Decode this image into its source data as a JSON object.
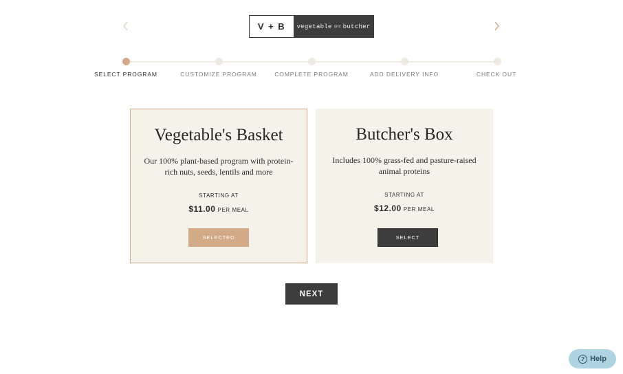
{
  "header": {
    "logo_mark": "V + B",
    "logo_word_left": "vegetable",
    "logo_word_and": "and",
    "logo_word_right": "butcher",
    "prev_icon": "chevron-left-icon",
    "next_icon": "chevron-right-icon",
    "prev_color": "#e0d3c4",
    "next_color": "#d2aa87"
  },
  "stepper": {
    "current_step": 1,
    "steps": [
      {
        "label": "SELECT PROGRAM"
      },
      {
        "label": "CUSTOMIZE PROGRAM"
      },
      {
        "label": "COMPLETE PROGRAM"
      },
      {
        "label": "ADD DELIVERY INFO"
      },
      {
        "label": "CHECK OUT"
      }
    ]
  },
  "programs": [
    {
      "title": "Vegetable's Basket",
      "description": "Our 100% plant-based program with protein-rich nuts, seeds, lentils and more",
      "starting_label": "STARTING AT",
      "price": "$11.00",
      "per_label": "PER MEAL",
      "button_label": "SELECTED",
      "selected": true
    },
    {
      "title": "Butcher's Box",
      "description": "Includes 100% grass-fed and pasture-raised animal proteins",
      "starting_label": "STARTING AT",
      "price": "$12.00",
      "per_label": "PER MEAL",
      "button_label": "SELECT",
      "selected": false
    }
  ],
  "actions": {
    "next_label": "NEXT"
  },
  "help": {
    "label": "Help",
    "icon": "question-circle-icon"
  },
  "colors": {
    "accent": "#d2aa87",
    "dark": "#3d3d3d",
    "card_bg": "#f5f2ea",
    "help_bg": "#aed4e2"
  }
}
